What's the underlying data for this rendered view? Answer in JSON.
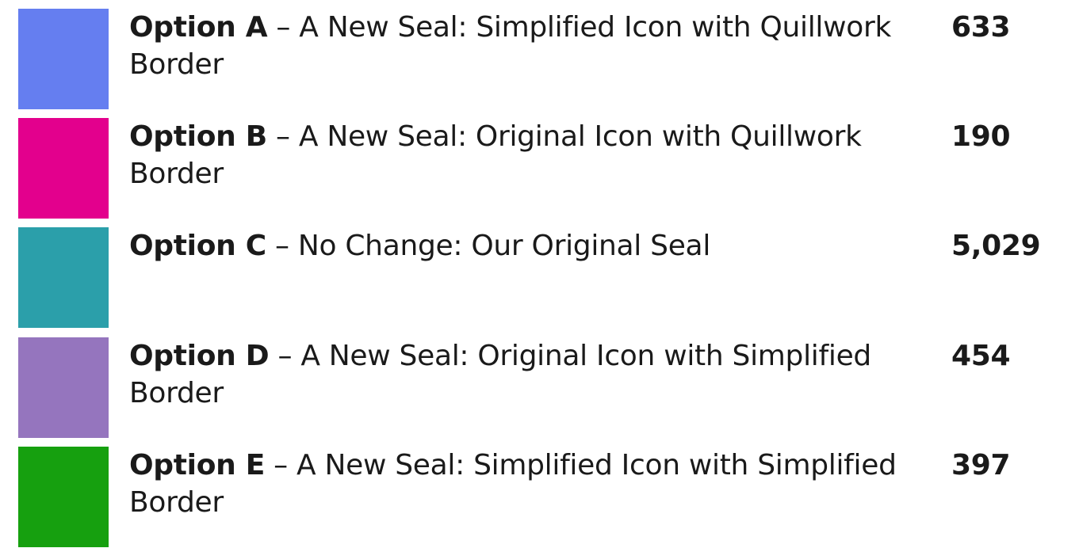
{
  "chart_data": {
    "type": "table",
    "entries": [
      {
        "option": "Option A",
        "separator": " – ",
        "description": "A New Seal: Simplified Icon with Quillwork Border",
        "count_label": "633",
        "count": 633,
        "color": "#657ef0"
      },
      {
        "option": "Option B",
        "separator": " – ",
        "description": "A New Seal: Original Icon with Quillwork Border",
        "count_label": "190",
        "count": 190,
        "color": "#e3008d"
      },
      {
        "option": "Option C",
        "separator": " – ",
        "description": "No Change: Our Original Seal",
        "count_label": "5,029",
        "count": 5029,
        "color": "#2b9faa"
      },
      {
        "option": "Option D",
        "separator": " – ",
        "description": "A New Seal: Original Icon with Simplified Border",
        "count_label": "454",
        "count": 454,
        "color": "#9575be"
      },
      {
        "option": "Option E",
        "separator": " – ",
        "description": "A New Seal: Simplified Icon with Simplified Border",
        "count_label": "397",
        "count": 397,
        "color": "#16a00f"
      }
    ]
  }
}
